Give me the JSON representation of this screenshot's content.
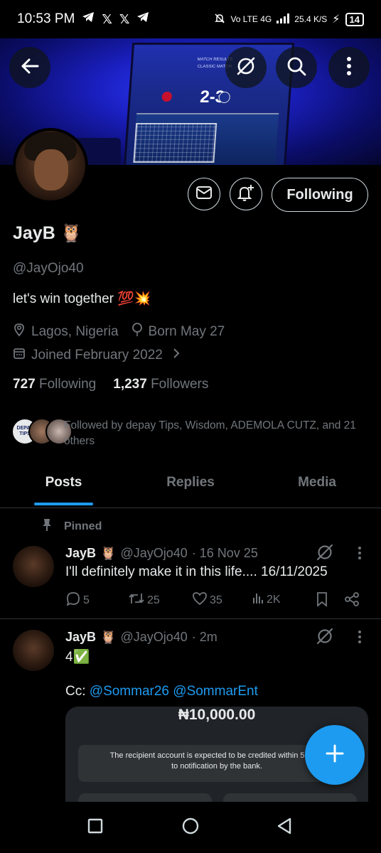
{
  "status_bar": {
    "time": "10:53 PM",
    "network": "Vo LTE 4G",
    "speed": "25.4 K/S",
    "battery": "14"
  },
  "banner": {
    "overlay_title": "MATCH RESULTS",
    "overlay_subtitle": "CLASSIC MATCH",
    "score": "2-3"
  },
  "profile": {
    "display_name": "JayB",
    "name_emoji": "🦉",
    "handle": "@JayOjo40",
    "bio": "let's win together 💯💥",
    "location": "Lagos, Nigeria",
    "birthday": "Born May 27",
    "joined": "Joined February 2022",
    "following_count": "727",
    "following_label": "Following",
    "followers_count": "1,237",
    "followers_label": "Followers",
    "followed_by": "Followed by depay Tips, Wisdom, ADEMOLA CUTZ, and 21 others",
    "mini_avatar_label": "DEPAY TIPS",
    "follow_button": "Following"
  },
  "tabs": [
    {
      "label": "Posts",
      "active": true
    },
    {
      "label": "Replies",
      "active": false
    },
    {
      "label": "Media",
      "active": false
    }
  ],
  "pinned_label": "Pinned",
  "tweets": [
    {
      "name": "JayB",
      "emoji": "🦉",
      "handle": "@JayOjo40",
      "time": "· 16 Nov 25",
      "text": "I'll definitely make it in this life.... 16/11/2025",
      "replies": "5",
      "reposts": "25",
      "likes": "35",
      "views": "2K"
    },
    {
      "name": "JayB",
      "emoji": "🦉",
      "handle": "@JayOjo40",
      "time": "· 2m",
      "text": "4✅",
      "cc_label": "Cc:",
      "mention_1": "@Sommar26",
      "mention_2": "@SommarEnt",
      "card_amount": "₦10,000.00",
      "card_note_line1": "The recipient account is expected to be credited within 5 minu",
      "card_note_line2": "to notification by the bank."
    }
  ],
  "colors": {
    "accent": "#1d9bf0",
    "background": "#000000",
    "text_primary": "#e7e9ea",
    "text_secondary": "#71767b"
  }
}
